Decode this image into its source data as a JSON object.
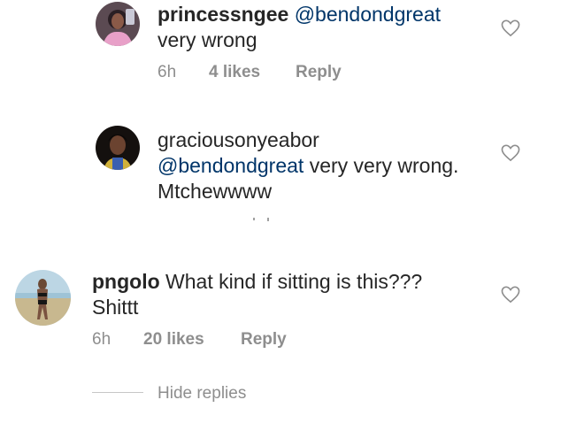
{
  "comments": [
    {
      "username": "princessngee",
      "mention": "@bendondgreat",
      "text": "very wrong",
      "time": "6h",
      "likes": "4 likes",
      "reply": "Reply",
      "icon": "heart-outline-icon"
    },
    {
      "username": "graciousonyeabor",
      "mention": "@bendondgreat",
      "text": " very very wrong.",
      "text_line2": "Mtchewwww",
      "icon": "heart-outline-icon"
    },
    {
      "username": "pngolo",
      "text": " What kind if sitting is this???",
      "text_line2": "Shittt",
      "time": "6h",
      "likes": "20 likes",
      "reply": "Reply",
      "icon": "heart-outline-icon"
    }
  ],
  "thread": {
    "hide_replies": "Hide replies"
  },
  "colors": {
    "text": "#262626",
    "mention": "#003569",
    "meta": "#8e8e8e",
    "divider": "#c7c7c7"
  }
}
